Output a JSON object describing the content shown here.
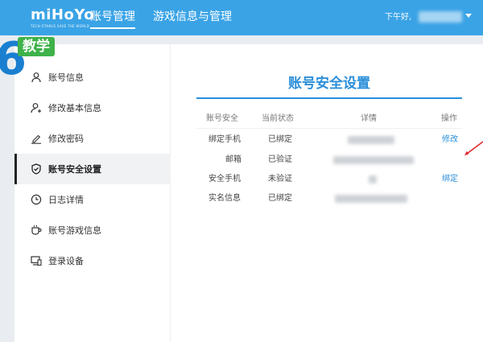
{
  "header": {
    "logo_text": "miHoYo",
    "logo_sub": "TECH OTAKUS SAVE THE WORLD",
    "nav": [
      {
        "label": "账号管理",
        "active": true
      },
      {
        "label": "游戏信息与管理",
        "active": false
      }
    ],
    "greeting": "下午好,",
    "user_dropdown_icon": "caret-down-icon"
  },
  "overlay": {
    "badge_label": "教学",
    "deco_text": "6"
  },
  "sidebar": {
    "items": [
      {
        "label": "账号信息",
        "icon": "user-icon",
        "active": false
      },
      {
        "label": "修改基本信息",
        "icon": "user-edit-icon",
        "active": false
      },
      {
        "label": "修改密码",
        "icon": "pencil-icon",
        "active": false
      },
      {
        "label": "账号安全设置",
        "icon": "shield-check-icon",
        "active": true
      },
      {
        "label": "日志详情",
        "icon": "clock-icon",
        "active": false
      },
      {
        "label": "账号游戏信息",
        "icon": "cup-icon",
        "active": false
      },
      {
        "label": "登录设备",
        "icon": "devices-icon",
        "active": false
      }
    ]
  },
  "main": {
    "title": "账号安全设置",
    "table": {
      "headers": [
        "账号安全",
        "当前状态",
        "详情",
        "操作"
      ],
      "rows": [
        {
          "item": "绑定手机",
          "status": "已绑定",
          "action": "修改"
        },
        {
          "item": "邮箱",
          "status": "已验证",
          "action": ""
        },
        {
          "item": "安全手机",
          "status": "未验证",
          "action": "绑定"
        },
        {
          "item": "实名信息",
          "status": "已绑定",
          "action": ""
        }
      ]
    }
  },
  "colors": {
    "topbar": "#3aa3e6",
    "accent": "#2b8fd9",
    "badge": "#3fb24a",
    "arrow": "#e0282e"
  }
}
